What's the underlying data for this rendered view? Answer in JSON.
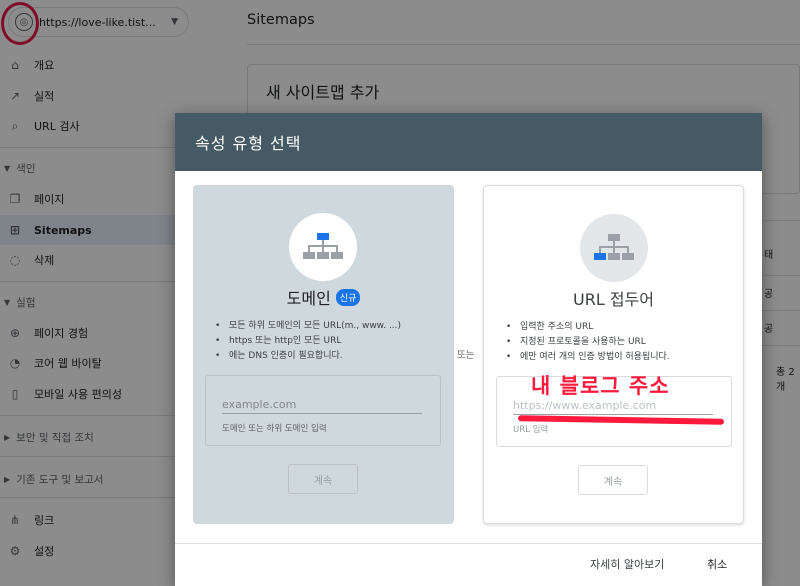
{
  "sidebar": {
    "property_url": "https://love-like.tist...",
    "items": {
      "overview": "개요",
      "performance": "실적",
      "url_inspection": "URL 검사",
      "index_section": "색인",
      "pages": "페이지",
      "sitemaps": "Sitemaps",
      "removals": "삭제",
      "experience_section": "실험",
      "page_experience": "페이지 경험",
      "core_web_vitals": "코어 웹 바이탈",
      "mobile_usability": "모바일 사용 편의성",
      "security_section": "보안 및 직접 조치",
      "legacy_section": "기존 도구 및 보고서",
      "links": "링크",
      "settings": "설정"
    }
  },
  "main": {
    "title": "Sitemaps",
    "add_sitemap_title": "새 사이트맵 추가",
    "partial_cells": [
      "태",
      "공",
      "공",
      "총 2개"
    ]
  },
  "dialog": {
    "title": "속성 유형 선택",
    "or_label": "또는",
    "domain": {
      "title": "도메인",
      "badge": "신규",
      "bullets": [
        "모든 하위 도메인의 모든 URL(m., www. ...)",
        "https 또는 http인 모든 URL",
        "에는 DNS 인증이 필요합니다."
      ],
      "placeholder": "example.com",
      "helper": "도메인 또는 하위 도메인 입력",
      "continue": "계속"
    },
    "url_prefix": {
      "title": "URL 접두어",
      "bullets": [
        "입력한 주소의 URL",
        "지정된 프로토콜을 사용하는 URL",
        "에만 여러 개의 인증 방법이 허용됩니다."
      ],
      "placeholder": "https://www.example.com",
      "helper": "URL 입력",
      "continue": "계속"
    },
    "footer": {
      "learn_more": "자세히 알아보기",
      "cancel": "취소"
    }
  },
  "annotation": {
    "text": "내 블로그 주소",
    "color": "#ff1a3c"
  },
  "colors": {
    "dialog_header": "#455a64",
    "domain_card": "#cfd8dc",
    "accent_blue": "#1a73e8"
  }
}
